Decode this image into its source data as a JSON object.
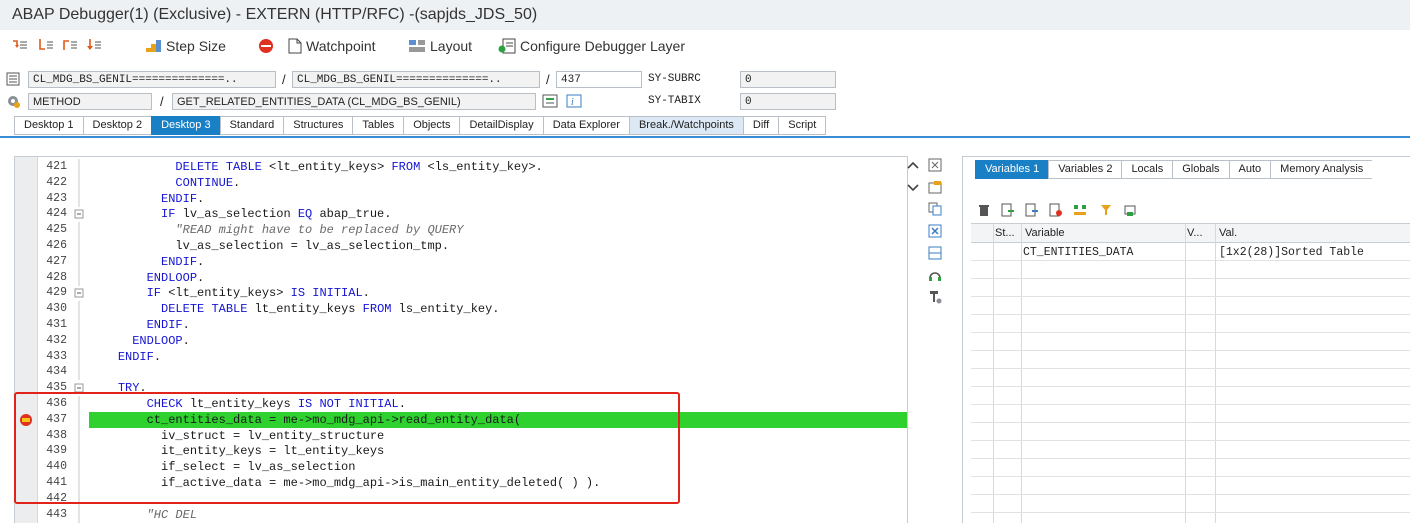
{
  "window": {
    "title": "ABAP Debugger(1)  (Exclusive) - EXTERN (HTTP/RFC) -(sapjds_JDS_50)"
  },
  "toolbar": {
    "step_size": "Step Size",
    "watchpoint": "Watchpoint",
    "layout": "Layout",
    "configure": "Configure Debugger Layer"
  },
  "header": {
    "program1": "CL_MDG_BS_GENIL==============..",
    "slash1": "/",
    "program2": "CL_MDG_BS_GENIL==============..",
    "slash2": "/",
    "line": "437",
    "sysubrc_label": "SY-SUBRC",
    "sysubrc_value": "0",
    "type": "METHOD",
    "slash3": "/",
    "method": "GET_RELATED_ENTITIES_DATA (CL_MDG_BS_GENIL)",
    "sytabix_label": "SY-TABIX",
    "sytabix_value": "0"
  },
  "tabs": [
    "Desktop 1",
    "Desktop 2",
    "Desktop 3",
    "Standard",
    "Structures",
    "Tables",
    "Objects",
    "DetailDisplay",
    "Data Explorer",
    "Break./Watchpoints",
    "Diff",
    "Script"
  ],
  "active_tab": "Desktop 3",
  "code": {
    "current_line": "437",
    "lines": [
      {
        "n": "421",
        "text": "            DELETE TABLE <lt_entity_keys> FROM <ls_entity_key>."
      },
      {
        "n": "422",
        "text": "            CONTINUE."
      },
      {
        "n": "423",
        "text": "          ENDIF."
      },
      {
        "n": "424",
        "text": "          IF lv_as_selection EQ abap_true."
      },
      {
        "n": "425",
        "text": "            \"READ might have to be replaced by QUERY"
      },
      {
        "n": "426",
        "text": "            lv_as_selection = lv_as_selection_tmp."
      },
      {
        "n": "427",
        "text": "          ENDIF."
      },
      {
        "n": "428",
        "text": "        ENDLOOP."
      },
      {
        "n": "429",
        "text": "        IF <lt_entity_keys> IS INITIAL."
      },
      {
        "n": "430",
        "text": "          DELETE TABLE lt_entity_keys FROM ls_entity_key."
      },
      {
        "n": "431",
        "text": "        ENDIF."
      },
      {
        "n": "432",
        "text": "      ENDLOOP."
      },
      {
        "n": "433",
        "text": "    ENDIF."
      },
      {
        "n": "434",
        "text": ""
      },
      {
        "n": "435",
        "text": "    TRY."
      },
      {
        "n": "436",
        "text": "        CHECK lt_entity_keys IS NOT INITIAL."
      },
      {
        "n": "437",
        "text": "        ct_entities_data = me->mo_mdg_api->read_entity_data("
      },
      {
        "n": "438",
        "text": "          iv_struct = lv_entity_structure"
      },
      {
        "n": "439",
        "text": "          it_entity_keys = lt_entity_keys"
      },
      {
        "n": "440",
        "text": "          if_select = lv_as_selection"
      },
      {
        "n": "441",
        "text": "          if_active_data = me->mo_mdg_api->is_main_entity_deleted( ) )."
      },
      {
        "n": "442",
        "text": ""
      },
      {
        "n": "443",
        "text": "        \"HC DEL"
      }
    ]
  },
  "right_tabs": [
    "Variables 1",
    "Variables 2",
    "Locals",
    "Globals",
    "Auto",
    "Memory Analysis"
  ],
  "right_active": "Variables 1",
  "vars": {
    "headers": {
      "st": "St...",
      "variable": "Variable",
      "v": "V...",
      "val": "Val."
    },
    "rows": [
      {
        "variable": "CT_ENTITIES_DATA",
        "value": "[1x2(28)]Sorted Table"
      }
    ]
  },
  "colors": {
    "accent": "#1a80c6",
    "current_line": "#2ed12e",
    "highlight_box": "#e2231a",
    "keyword": "#1414d2"
  }
}
